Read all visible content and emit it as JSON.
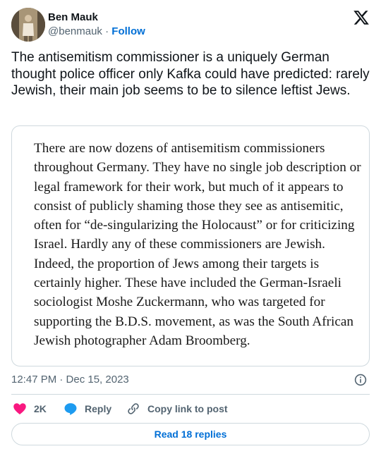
{
  "author": {
    "display_name": "Ben Mauk",
    "handle": "@benmauk",
    "separator": "·",
    "follow_label": "Follow"
  },
  "tweet": {
    "text": "The antisemitism commissioner is a uniquely German thought police officer only Kafka could have predicted: rarely Jewish, their main job seems to be to silence leftist Jews."
  },
  "media": {
    "quote_text": "There are now dozens of antisemitism commissioners throughout Germany. They have no single job description or legal framework for their work, but much of it appears to consist of publicly shaming those they see as antisemitic, often for “de-singularizing the Holocaust” or for criticizing Israel. Hardly any of these commissioners are Jewish. Indeed, the proportion of Jews among their targets is certainly higher. These have included the German-Israeli sociologist Moshe Zuckermann, who was targeted for supporting the B.D.S. movement, as was the South African Jewish photographer Adam Broomberg."
  },
  "meta": {
    "timestamp": "12:47 PM · Dec 15, 2023"
  },
  "actions": {
    "like_count": "2K",
    "reply_label": "Reply",
    "copy_link_label": "Copy link to post"
  },
  "replies_button": {
    "label": "Read 18 replies"
  },
  "colors": {
    "accent": "#006fd6",
    "like": "#f91880",
    "reply": "#1d9bf0",
    "secondary_text": "#536471",
    "border": "#cfd9de"
  },
  "icons": {
    "logo": "x-logo-icon",
    "info": "info-icon",
    "like": "heart-icon",
    "reply": "speech-bubble-icon",
    "copy_link": "link-icon"
  }
}
